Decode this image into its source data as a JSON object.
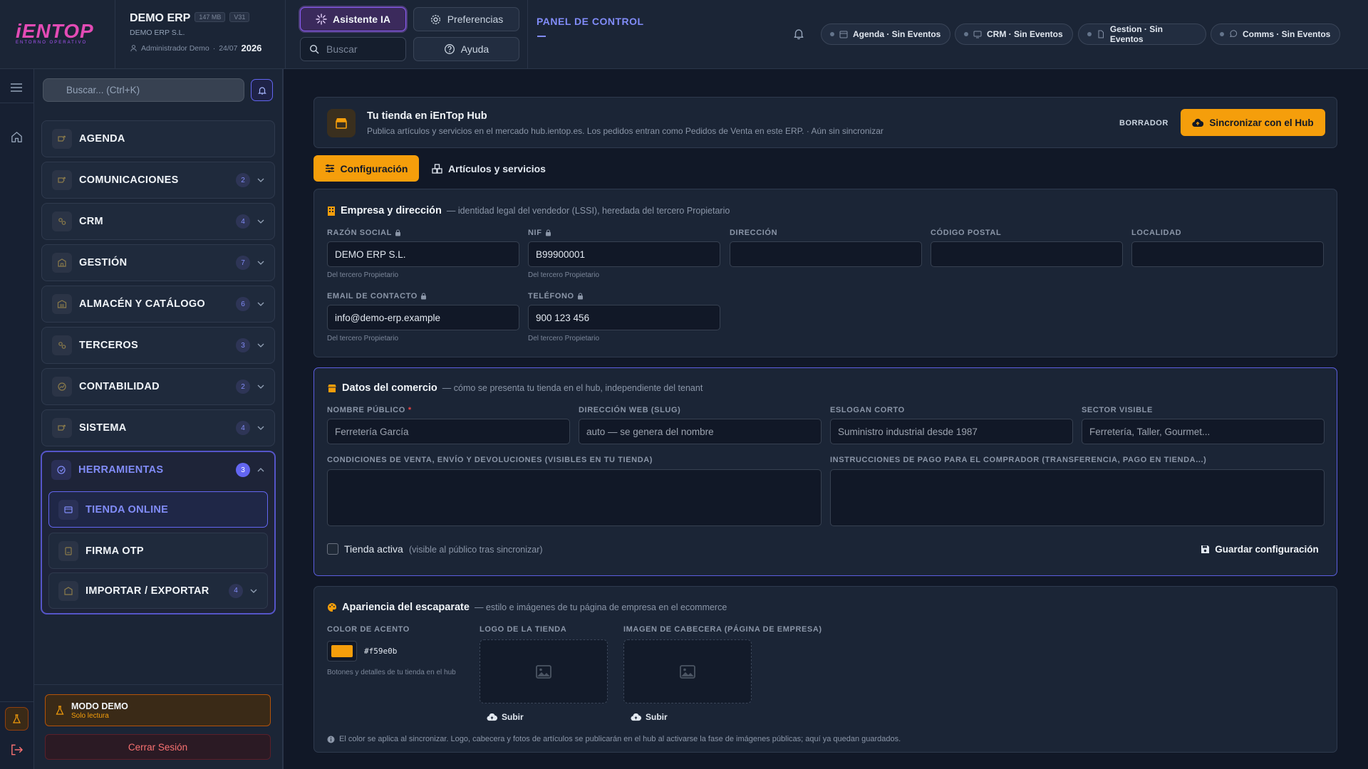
{
  "topbar": {
    "logo_text": "iENTOP",
    "logo_sub": "ENTORNO OPERATIVO",
    "company_name": "DEMO ERP",
    "size_chip": "147 MB",
    "version_chip": "V31",
    "company_legal": "DEMO ERP S.L.",
    "user": "Administrador Demo",
    "date": "24/07",
    "year": "2026",
    "ai_label": "Asistente IA",
    "prefs_label": "Preferencias",
    "search_placeholder": "Buscar",
    "help_label": "Ayuda",
    "panel_title": "PANEL DE CONTROL",
    "events": [
      {
        "label": "Agenda · Sin Eventos",
        "icon": "calendar-icon"
      },
      {
        "label": "CRM · Sin Eventos",
        "icon": "monitor-icon"
      },
      {
        "label": "Gestion · Sin Eventos",
        "icon": "document-icon"
      },
      {
        "label": "Comms · Sin Eventos",
        "icon": "chat-icon"
      }
    ]
  },
  "sidebar": {
    "search_placeholder": "Buscar... (Ctrl+K)",
    "items": [
      {
        "label": "AGENDA",
        "count": ""
      },
      {
        "label": "COMUNICACIONES",
        "count": "2"
      },
      {
        "label": "CRM",
        "count": "4"
      },
      {
        "label": "GESTIÓN",
        "count": "7"
      },
      {
        "label": "ALMACÉN Y CATÁLOGO",
        "count": "6"
      },
      {
        "label": "TERCEROS",
        "count": "3"
      },
      {
        "label": "CONTABILIDAD",
        "count": "2"
      },
      {
        "label": "SISTEMA",
        "count": "4"
      }
    ],
    "group": {
      "label": "HERRAMIENTAS",
      "count": "3",
      "children": [
        {
          "label": "TIENDA ONLINE",
          "count": ""
        },
        {
          "label": "FIRMA OTP",
          "count": ""
        },
        {
          "label": "IMPORTAR / EXPORTAR",
          "count": "4"
        }
      ]
    },
    "demo_title": "MODO DEMO",
    "demo_sub": "Solo lectura",
    "logout_label": "Cerrar Sesión"
  },
  "hub": {
    "title": "Tu tienda en iEnTop Hub",
    "desc": "Publica artículos y servicios en el mercado hub.ientop.es. Los pedidos entran como Pedidos de Venta en este ERP. · Aún sin sincronizar",
    "status": "BORRADOR",
    "sync_label": "Sincronizar con el Hub"
  },
  "tabs": [
    {
      "label": "Configuración",
      "active": true
    },
    {
      "label": "Artículos y servicios",
      "active": false
    }
  ],
  "empresa": {
    "title": "Empresa y dirección",
    "desc": "— identidad legal del vendedor (LSSI), heredada del tercero Propietario",
    "fields": {
      "razon_label": "RAZÓN SOCIAL",
      "razon_value": "DEMO ERP S.L.",
      "razon_hint": "Del tercero Propietario",
      "nif_label": "NIF",
      "nif_value": "B99900001",
      "nif_hint": "Del tercero Propietario",
      "direccion_label": "DIRECCIÓN",
      "cp_label": "CÓDIGO POSTAL",
      "localidad_label": "LOCALIDAD",
      "email_label": "EMAIL DE CONTACTO",
      "email_value": "info@demo-erp.example",
      "email_hint": "Del tercero Propietario",
      "telefono_label": "TELÉFONO",
      "telefono_value": "900 123 456",
      "telefono_hint": "Del tercero Propietario"
    }
  },
  "comercio": {
    "title": "Datos del comercio",
    "desc": "— cómo se presenta tu tienda en el hub, independiente del tenant",
    "nombre_label": "NOMBRE PÚBLICO",
    "required_mark": "*",
    "nombre_placeholder": "Ferretería García",
    "slug_label": "DIRECCIÓN WEB (SLUG)",
    "slug_placeholder": "auto — se genera del nombre",
    "eslogan_label": "ESLOGAN CORTO",
    "eslogan_placeholder": "Suministro industrial desde 1987",
    "sector_label": "SECTOR VISIBLE",
    "sector_placeholder": "Ferretería, Taller, Gourmet...",
    "condiciones_label": "CONDICIONES DE VENTA, ENVÍO Y DEVOLUCIONES (VISIBLES EN TU TIENDA)",
    "pago_label": "INSTRUCCIONES DE PAGO PARA EL COMPRADOR (TRANSFERENCIA, PAGO EN TIENDA...)",
    "activa_label": "Tienda activa",
    "activa_hint": "(visible al público tras sincronizar)",
    "activa_checked": false,
    "save_label": "Guardar configuración"
  },
  "apariencia": {
    "title": "Apariencia del escaparate",
    "desc": "— estilo e imágenes de tu página de empresa en el ecommerce",
    "color_label": "COLOR DE ACENTO",
    "color_value": "#f59e0b",
    "color_hint": "Botones y detalles de tu tienda en el hub",
    "logo_label": "LOGO DE LA TIENDA",
    "cabecera_label": "IMAGEN DE CABECERA (PÁGINA DE EMPRESA)",
    "upload_label": "Subir",
    "note": "El color se aplica al sincronizar. Logo, cabecera y fotos de artículos se publicarán en el hub al activarse la fase de imágenes públicas; aquí ya quedan guardados."
  },
  "colors": {
    "accent": "#f59e0b",
    "primary": "#818cf8",
    "background": "#111827",
    "panel": "#1b2536"
  }
}
